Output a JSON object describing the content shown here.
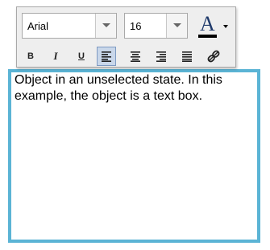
{
  "toolbar": {
    "font_family": "Arial",
    "font_size": "16",
    "font_color_letter": "A",
    "bold_label": "B",
    "italic_label": "I",
    "underline_label": "U"
  },
  "textbox": {
    "content": "Object in an unselected state. In this example, the object is a text box."
  },
  "colors": {
    "textbox_border": "#5bb4d5",
    "active_button": "#c9d7ea"
  },
  "icons": [
    "font-color-icon",
    "align-left-icon",
    "align-center-icon",
    "align-right-icon",
    "align-justify-icon",
    "link-icon"
  ]
}
